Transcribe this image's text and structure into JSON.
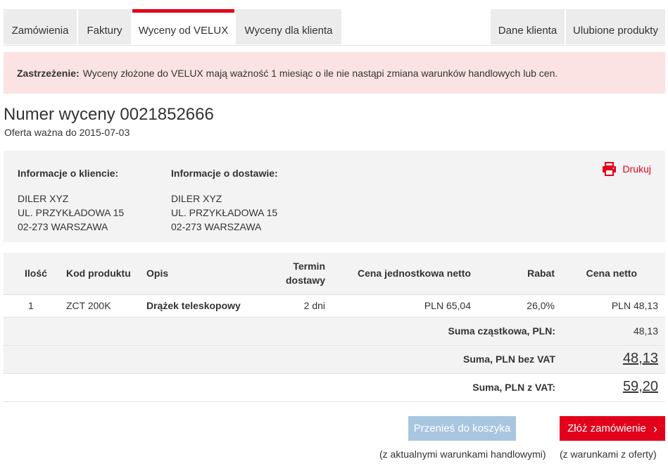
{
  "tabs": {
    "orders": "Zamówienia",
    "invoices": "Faktury",
    "velux_quotes": "Wyceny od VELUX",
    "client_quotes": "Wyceny dla klienta",
    "client_data": "Dane klienta",
    "favorites": "Ulubione produkty"
  },
  "notice": {
    "label": "Zastrzeżenie:",
    "text": "Wyceny złożone do VELUX mają ważność 1 miesiąc o ile nie nastąpi zmiana warunków handlowych lub cen."
  },
  "quote": {
    "title": "Numer wyceny 0021852666",
    "valid_until": "Oferta ważna do 2015-07-03"
  },
  "client_info": {
    "heading": "Informacje o kliencie:",
    "lines": [
      "DILER XYZ",
      "UL. PRZYKŁADOWA 15",
      "02-273 WARSZAWA"
    ]
  },
  "delivery_info": {
    "heading": "Informacje o dostawie:",
    "lines": [
      "DILER XYZ",
      "UL. PRZYKŁADOWA 15",
      "02-273 WARSZAWA"
    ]
  },
  "print": {
    "label": "Drukuj",
    "icon": "printer-icon"
  },
  "table": {
    "headers": {
      "qty": "Ilość",
      "code": "Kod produktu",
      "desc": "Opis",
      "term_line1": "Termin",
      "term_line2": "dostawy",
      "unit_price": "Cena jednostkowa netto",
      "discount": "Rabat",
      "net_price": "Cena netto"
    },
    "rows": [
      {
        "qty": "1",
        "code": "ZCT 200K",
        "desc": "Drążek teleskopowy",
        "term": "2 dni",
        "unit_price": "PLN 65,04",
        "discount": "26,0%",
        "net_price": "PLN 48,13"
      }
    ]
  },
  "totals": {
    "subtotal_label": "Suma cząstkowa, PLN:",
    "subtotal_value": "48,13",
    "net_label": "Suma, PLN bez VAT",
    "net_value": "48,13",
    "gross_label": "Suma, PLN z VAT:",
    "gross_value": "59,20"
  },
  "actions": {
    "move_to_cart": "Przenieś do koszyka",
    "move_note": "(z aktualnymi warunkami handlowymi)",
    "place_order": "Złóż zamówienie",
    "order_note": "(z warunkami z oferty)"
  },
  "colors": {
    "accent": "#e2001a",
    "notice_bg": "#fbe3e3",
    "panel_bg": "#f3f3f3",
    "disabled_button": "#a9c6e0"
  }
}
